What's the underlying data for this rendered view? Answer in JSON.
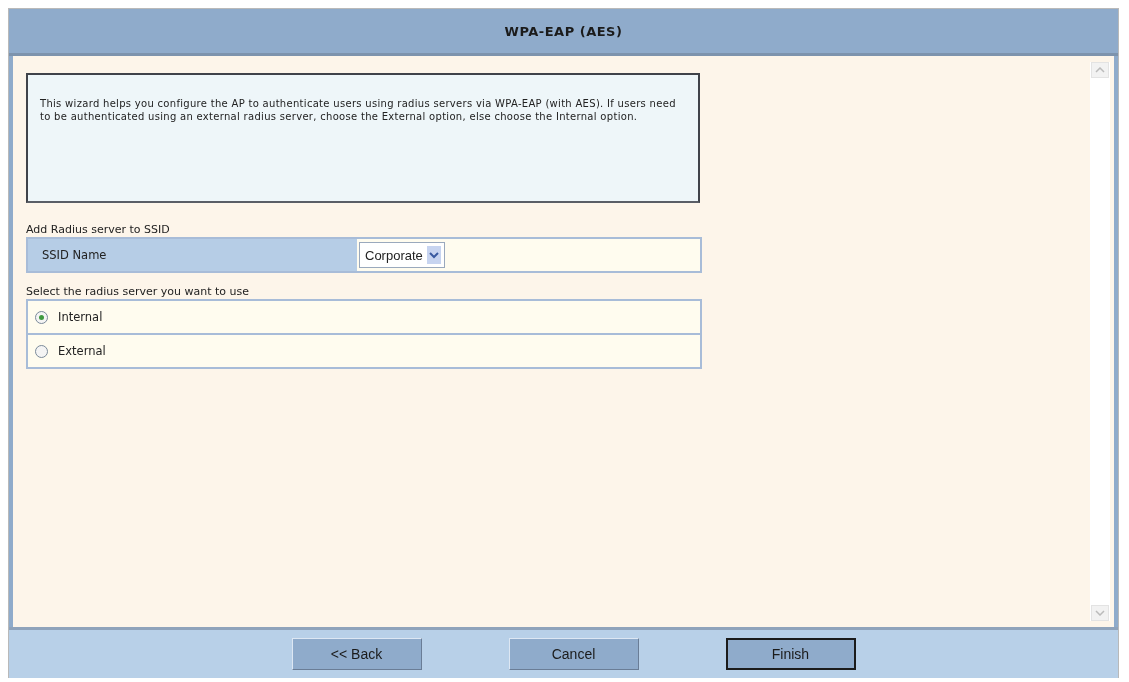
{
  "window": {
    "title": "WPA-EAP (AES)"
  },
  "intro": "This wizard helps you configure the AP to authenticate users using radius servers via WPA-EAP (with AES). If users need to be authenticated using an external radius server, choose the External option, else choose the Internal option.",
  "ssid_section": {
    "heading": "Add Radius server to SSID",
    "label": "SSID Name",
    "value": "Corporate"
  },
  "server_section": {
    "heading": "Select the radius server you want to use",
    "options": [
      {
        "label": "Internal",
        "selected": true
      },
      {
        "label": "External",
        "selected": false
      }
    ]
  },
  "buttons": [
    {
      "label": "<< Back",
      "default": false
    },
    {
      "label": "Cancel",
      "default": false
    },
    {
      "label": "Finish",
      "default": true
    }
  ]
}
